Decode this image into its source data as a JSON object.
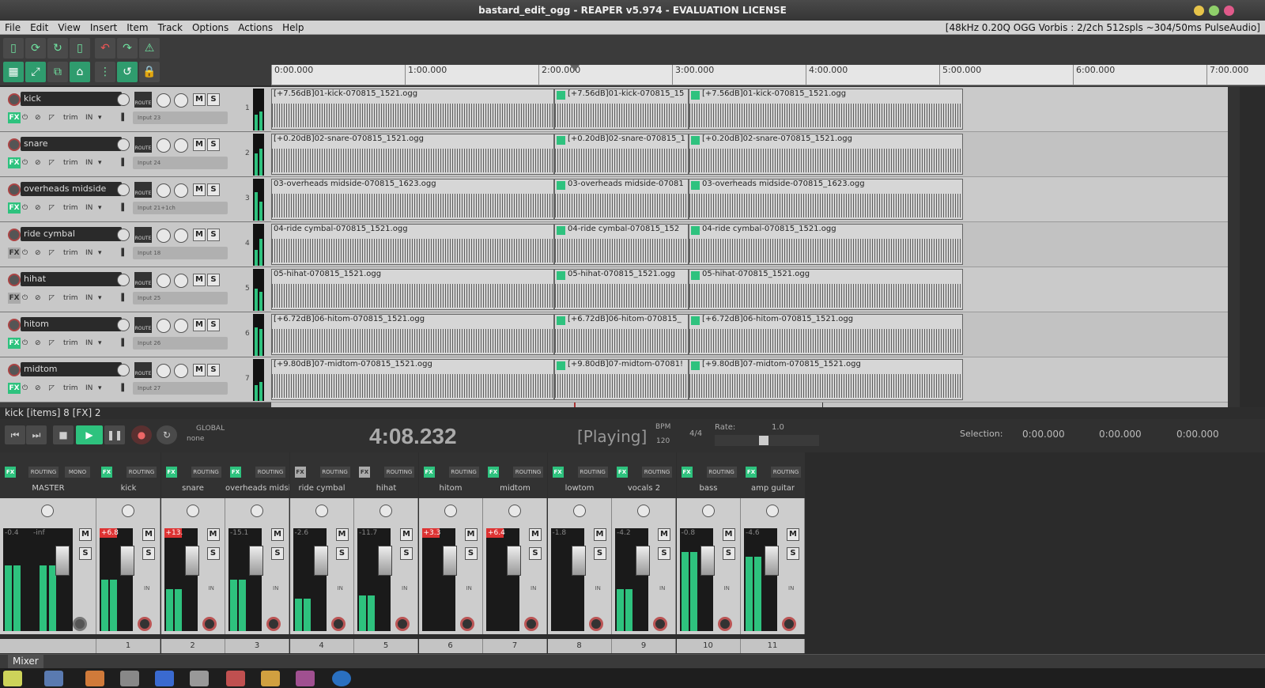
{
  "window": {
    "title": "bastard_edit_ogg - REAPER v5.974 - EVALUATION LICENSE"
  },
  "menu": [
    "File",
    "Edit",
    "View",
    "Insert",
    "Item",
    "Track",
    "Options",
    "Actions",
    "Help"
  ],
  "audio_status": "[48kHz 0.20Q OGG Vorbis : 2/2ch 512spls ~304/50ms PulseAudio]",
  "ruler": [
    "0:00.000",
    "1:00.000",
    "2:00.000",
    "3:00.000",
    "4:00.000",
    "5:00.000",
    "6:00.000",
    "7:00.000"
  ],
  "tracks": [
    {
      "num": "1",
      "name": "kick",
      "input": "Input 23",
      "items": [
        "[+7.56dB]01-kick-070815_1521.ogg",
        "[+7.56dB]01-kick-070815_15",
        "[+7.56dB]01-kick-070815_1521.ogg"
      ]
    },
    {
      "num": "2",
      "name": "snare",
      "input": "Input 24",
      "items": [
        "[+0.20dB]02-snare-070815_1521.ogg",
        "[+0.20dB]02-snare-070815_1",
        "[+0.20dB]02-snare-070815_1521.ogg"
      ]
    },
    {
      "num": "3",
      "name": "overheads midside",
      "input": "Input 21+1ch",
      "items": [
        "03-overheads midside-070815_1623.ogg",
        "03-overheads midside-07081",
        "03-overheads midside-070815_1623.ogg"
      ]
    },
    {
      "num": "4",
      "name": "ride cymbal",
      "input": "Input 18",
      "items": [
        "04-ride cymbal-070815_1521.ogg",
        "04-ride cymbal-070815_152",
        "04-ride cymbal-070815_1521.ogg"
      ]
    },
    {
      "num": "5",
      "name": "hihat",
      "input": "Input 25",
      "items": [
        "05-hihat-070815_1521.ogg",
        "05-hihat-070815_1521.ogg",
        "05-hihat-070815_1521.ogg"
      ]
    },
    {
      "num": "6",
      "name": "hitom",
      "input": "Input 26",
      "items": [
        "[+6.72dB]06-hitom-070815_1521.ogg",
        "[+6.72dB]06-hitom-070815_",
        "[+6.72dB]06-hitom-070815_1521.ogg"
      ]
    },
    {
      "num": "7",
      "name": "midtom",
      "input": "Input 27",
      "items": [
        "[+9.80dB]07-midtom-070815_1521.ogg",
        "[+9.80dB]07-midtom-07081!",
        "[+9.80dB]07-midtom-070815_1521.ogg"
      ]
    }
  ],
  "track_labels": {
    "trim": "trim",
    "in": "IN",
    "route": "ROUTE",
    "m": "M",
    "s": "S",
    "fx": "FX"
  },
  "info_line": "kick [items] 8 [FX] 2",
  "transport": {
    "time": "4:08.232",
    "state": "[Playing]",
    "bpm_label": "BPM",
    "bpm": "120",
    "timesig": "4/4",
    "rate_label": "Rate:",
    "rate": "1.0",
    "global_label": "GLOBAL",
    "global_mode": "none",
    "selection_label": "Selection:",
    "sel_start": "0:00.000",
    "sel_end": "0:00.000",
    "sel_len": "0:00.000"
  },
  "mixer": {
    "routing_label": "ROUTING",
    "mono_label": "MONO",
    "strips": [
      {
        "name": "MASTER",
        "num": "",
        "peak": "-0.4",
        "peak2": "-inf",
        "level": 0.7,
        "fx": true
      },
      {
        "name": "kick",
        "num": "1",
        "peak": "+6.8",
        "red": true,
        "level": 0.55,
        "fx": true
      },
      {
        "name": "snare",
        "num": "2",
        "peak": "+13.",
        "red": true,
        "level": 0.45,
        "fx": true
      },
      {
        "name": "overheads midsi",
        "num": "3",
        "peak": "-15.1",
        "level": 0.55,
        "fx": true
      },
      {
        "name": "ride cymbal",
        "num": "4",
        "peak": "-2.6",
        "level": 0.35,
        "fx": false
      },
      {
        "name": "hihat",
        "num": "5",
        "peak": "-11.7",
        "level": 0.38,
        "fx": false
      },
      {
        "name": "hitom",
        "num": "6",
        "peak": "+3.3",
        "red": true,
        "level": 0.0,
        "fx": true
      },
      {
        "name": "midtom",
        "num": "7",
        "peak": "+6.4",
        "red": true,
        "level": 0.0,
        "fx": true
      },
      {
        "name": "lowtom",
        "num": "8",
        "peak": "-1.8",
        "level": 0.0,
        "fx": true
      },
      {
        "name": "vocals 2",
        "num": "9",
        "peak": "-4.2",
        "level": 0.45,
        "fx": true
      },
      {
        "name": "bass",
        "num": "10",
        "peak": "-0.8",
        "level": 0.85,
        "fx": true
      },
      {
        "name": "amp guitar",
        "num": "11",
        "peak": "-4.6",
        "level": 0.8,
        "fx": true
      }
    ]
  },
  "mixer_tab": "Mixer",
  "colors": {
    "accent": "#2ec27e",
    "record": "#d33",
    "bg": "#2b2b2b"
  }
}
